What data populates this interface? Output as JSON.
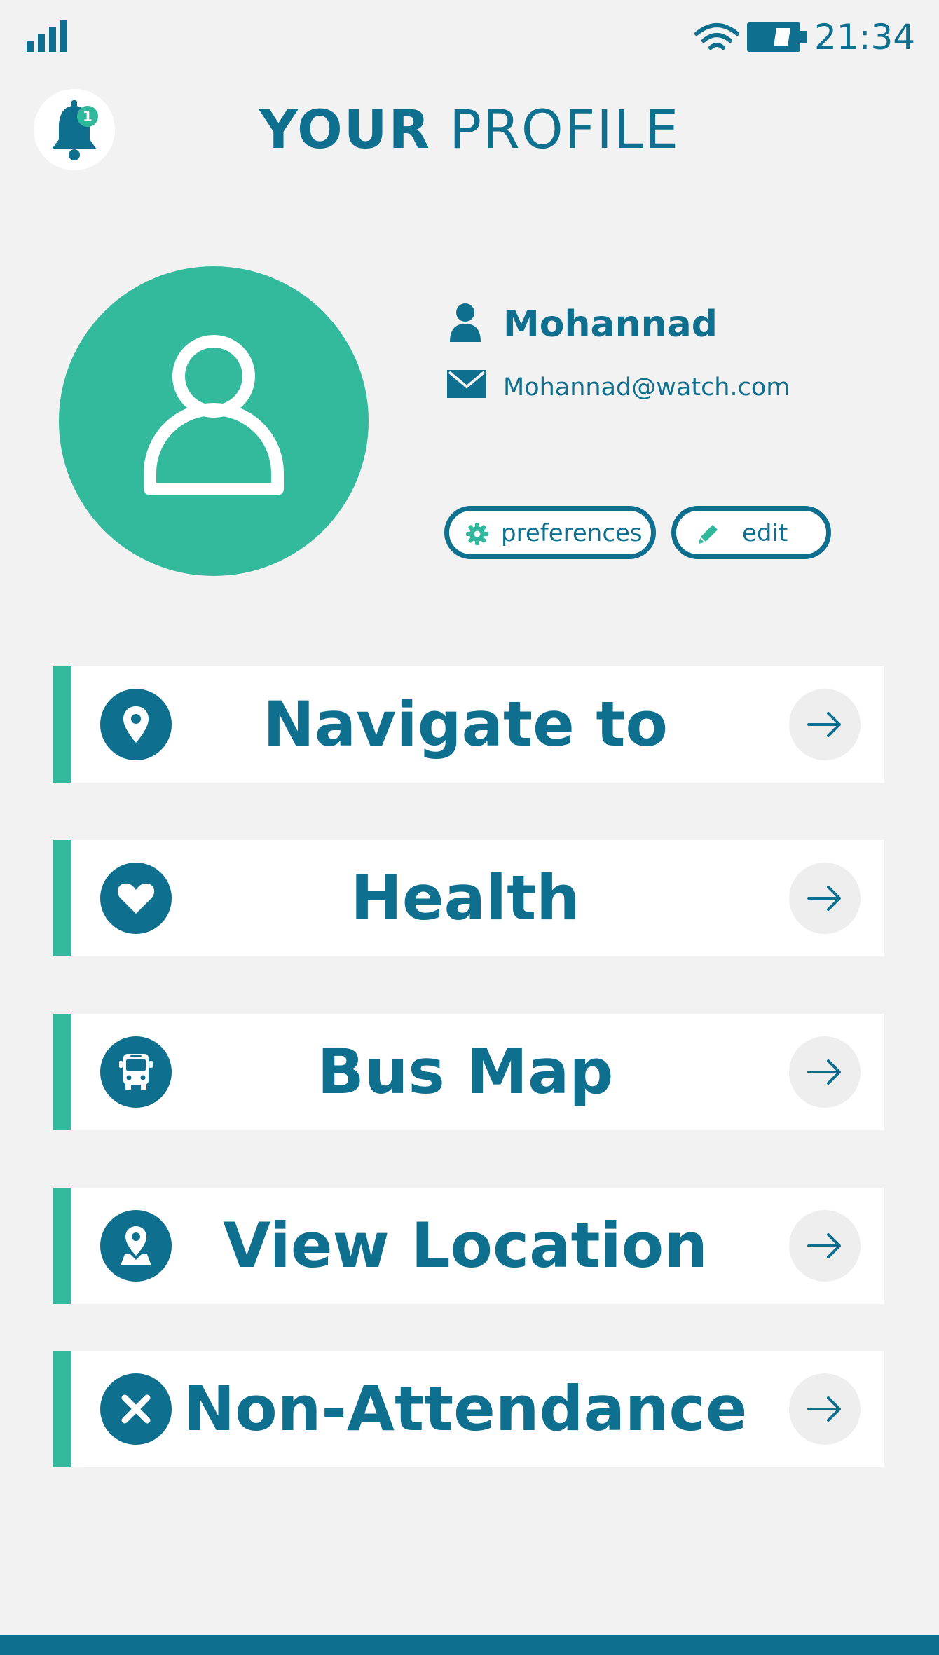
{
  "status_bar": {
    "time": "21:34"
  },
  "notifications": {
    "count": "1"
  },
  "header": {
    "title_strong": "YOUR",
    "title_light": "PROFILE"
  },
  "profile": {
    "name": "Mohannad",
    "email": "Mohannad@watch.com"
  },
  "actions": {
    "preferences_label": "preferences",
    "edit_label": "edit"
  },
  "menu": [
    {
      "label": "Navigate to",
      "icon": "location-pin-icon"
    },
    {
      "label": "Health",
      "icon": "heart-icon"
    },
    {
      "label": "Bus Map",
      "icon": "bus-icon"
    },
    {
      "label": "View Location",
      "icon": "map-pin-icon"
    },
    {
      "label": "Non-Attendance",
      "icon": "close-icon"
    }
  ],
  "colors": {
    "primary": "#0e6f8f",
    "accent": "#33b99c",
    "background": "#f2f2f2"
  }
}
